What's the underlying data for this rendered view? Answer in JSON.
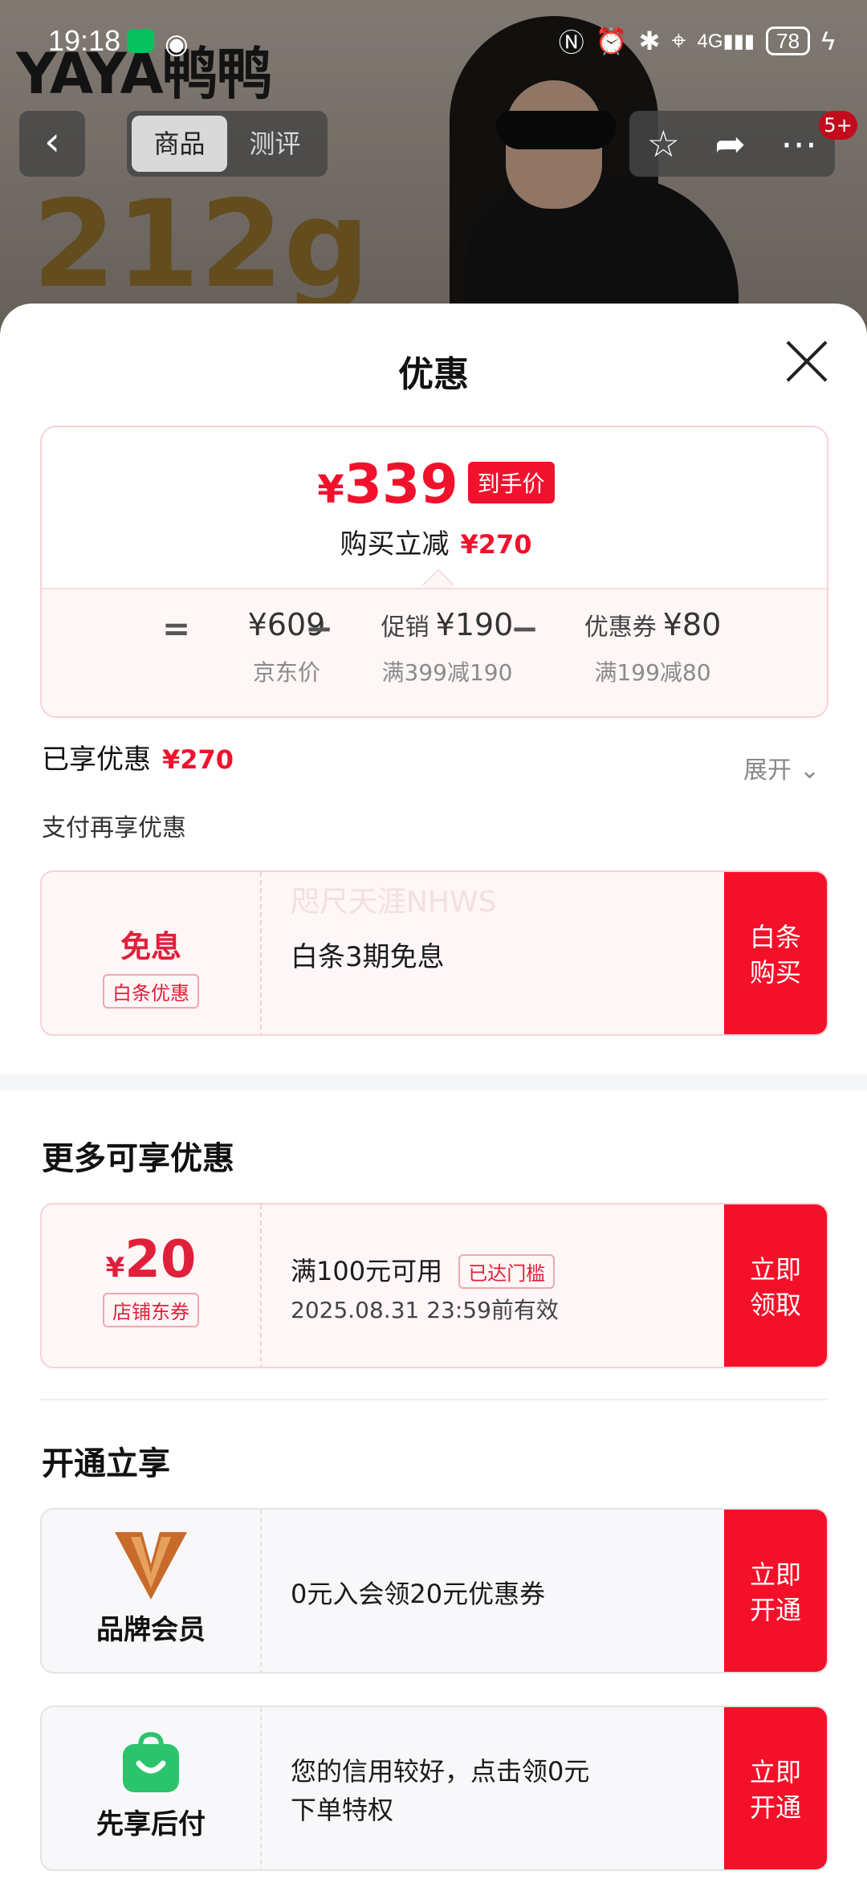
{
  "status_bar": {
    "time": "19:18",
    "battery": "78"
  },
  "background_page": {
    "brand": "YAYA鸭鸭",
    "weight": "212g"
  },
  "nav": {
    "tabs": [
      {
        "label": "商品",
        "active": true
      },
      {
        "label": "测评",
        "active": false
      }
    ],
    "badge": "5+"
  },
  "sheet": {
    "title": "优惠",
    "price": {
      "currency": "¥",
      "final": "339",
      "tag": "到手价",
      "reduce_label": "购买立减",
      "reduce_value": "¥270"
    },
    "breakdown": {
      "eq": "=",
      "op": "−",
      "items": [
        {
          "label": "",
          "value": "¥609",
          "note": "京东价"
        },
        {
          "label": "促销",
          "value": "¥190",
          "note": "满399减190"
        },
        {
          "label": "优惠券",
          "value": "¥80",
          "note": "满199减80"
        }
      ]
    },
    "enjoyed": {
      "label": "已享优惠",
      "value": "¥270",
      "expand": "展开"
    },
    "pay_more": "支付再享优惠",
    "baitiao": {
      "title": "免息",
      "tag": "白条优惠",
      "desc": "白条3期免息",
      "watermark": "咫尺天涯NHWS",
      "button_line1": "白条",
      "button_line2": "购买"
    },
    "more_title": "更多可享优惠",
    "shop_coupon": {
      "currency": "¥",
      "amount": "20",
      "tag": "店铺东券",
      "condition": "满100元可用",
      "reached": "已达门槛",
      "validity": "2025.08.31 23:59前有效",
      "button_line1": "立即",
      "button_line2": "领取"
    },
    "open_title": "开通立享",
    "brand_member": {
      "name": "品牌会员",
      "desc": "0元入会领20元优惠券",
      "button_line1": "立即",
      "button_line2": "开通"
    },
    "pay_later": {
      "name": "先享后付",
      "desc_line1": "您的信用较好，点击领0元",
      "desc_line2": "下单特权",
      "button_line1": "立即",
      "button_line2": "开通"
    }
  },
  "colors": {
    "accent": "#f0122c",
    "button": "#f5102a",
    "card_border": "#f7d2d6",
    "member_logo": "#c86b2a",
    "pay_later_icon": "#2bc36b"
  }
}
